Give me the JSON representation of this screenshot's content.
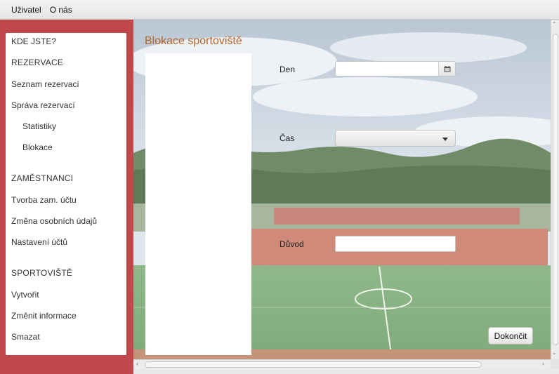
{
  "menubar": {
    "items": [
      "Uživatel",
      "O nás"
    ]
  },
  "sidebar": {
    "items": [
      {
        "label": "KDE JSTE?"
      },
      {
        "label": "REZERVACE"
      },
      {
        "label": "Seznam rezervací"
      },
      {
        "label": "Správa rezervací"
      },
      {
        "label": "Statistiky"
      },
      {
        "label": "Blokace"
      },
      {
        "label": "ZAMĚSTNANCI"
      },
      {
        "label": "Tvorba zam. účtu"
      },
      {
        "label": "Změna osobních údajů"
      },
      {
        "label": "Nastavení účtů"
      },
      {
        "label": "SPORTOVIŠTĚ"
      },
      {
        "label": "Vytvořit"
      },
      {
        "label": "Změnit informace"
      },
      {
        "label": "Smazat"
      }
    ]
  },
  "page": {
    "title": "Blokace sportoviště",
    "fields": {
      "day_label": "Den",
      "day_value": "",
      "time_label": "Čas",
      "time_value": "",
      "reason_label": "Důvod",
      "reason_value": ""
    },
    "finish_label": "Dokončit"
  },
  "icons": {
    "date_picker": "calendar-icon",
    "select_arrow": "chevron-down-icon"
  },
  "colors": {
    "sidebar_frame": "#c0484a",
    "title": "#b5652b"
  }
}
